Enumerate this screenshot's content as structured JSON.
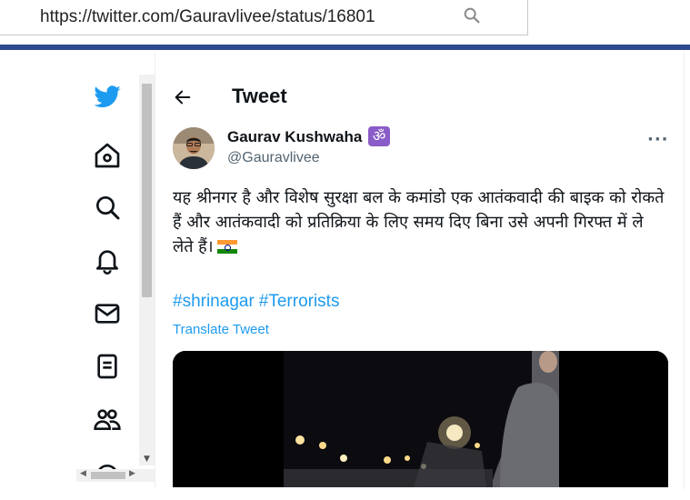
{
  "browser": {
    "url": "https://twitter.com/Gauravlivee/status/16801"
  },
  "colors": {
    "accent": "#1d9bf0",
    "browser_rule": "#2e4a8e",
    "badge": "#8a5cc7"
  },
  "sidebar": {
    "items": [
      {
        "icon": "twitter-logo-icon"
      },
      {
        "icon": "home-icon"
      },
      {
        "icon": "search-icon"
      },
      {
        "icon": "bell-icon"
      },
      {
        "icon": "mail-icon"
      },
      {
        "icon": "list-icon"
      },
      {
        "icon": "communities-icon"
      },
      {
        "icon": "settings-icon"
      }
    ]
  },
  "header": {
    "title": "Tweet"
  },
  "tweet": {
    "author_name": "Gaurav Kushwaha",
    "badge_glyph": "ॐ",
    "handle": "@Gauravlivee",
    "more": "···",
    "text": "यह श्रीनगर है और विशेष सुरक्षा बल के कमांडो एक आतंकवादी की बाइक को रोकते हैं और आतंकवादी को प्रतिक्रिया के लिए समय दिए बिना उसे अपनी गिरफ्त में ले लेते हैं।",
    "hashtags": [
      "#shrinagar",
      "#Terrorists"
    ],
    "translate_label": "Translate Tweet"
  }
}
